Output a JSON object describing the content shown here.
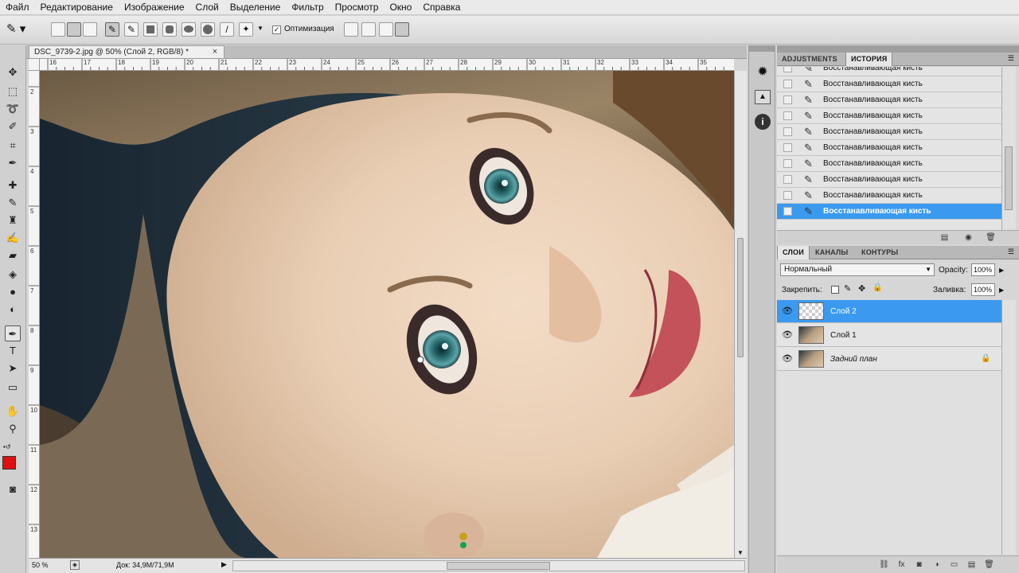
{
  "menu": [
    "Файл",
    "Редактирование",
    "Изображение",
    "Слой",
    "Выделение",
    "Фильтр",
    "Просмотр",
    "Окно",
    "Справка"
  ],
  "options_bar": {
    "optimize_label": "Оптимизация"
  },
  "document": {
    "tab_title": "DSC_9739-2.jpg @ 50% (Слой 2, RGB/8) *",
    "close_glyph": "×",
    "hruler_ticks": [
      "16",
      "17",
      "18",
      "19",
      "20",
      "21",
      "22",
      "23",
      "24",
      "25",
      "26",
      "27",
      "28",
      "29",
      "30",
      "31",
      "32",
      "33",
      "34",
      "35"
    ],
    "vruler_ticks": [
      "2",
      "3",
      "4",
      "5",
      "6",
      "7",
      "8",
      "9",
      "10",
      "11",
      "12",
      "13"
    ],
    "zoom": "50 %",
    "doc_info": "Док: 34,9M/71,9M"
  },
  "history_panel": {
    "tabs": [
      "ADJUSTMENTS",
      "ИСТОРИЯ"
    ],
    "active_tab": "ИСТОРИЯ",
    "items": [
      "Восстанавливающая кисть",
      "Восстанавливающая кисть",
      "Восстанавливающая кисть",
      "Восстанавливающая кисть",
      "Восстанавливающая кисть",
      "Восстанавливающая кисть",
      "Восстанавливающая кисть",
      "Восстанавливающая кисть",
      "Восстанавливающая кисть",
      "Восстанавливающая кисть"
    ],
    "selected_index": 9
  },
  "layers_panel": {
    "tabs": [
      "СЛОИ",
      "КАНАЛЫ",
      "КОНТУРЫ"
    ],
    "active_tab": "СЛОИ",
    "blend_mode": "Нормальный",
    "opacity_label": "Opacity:",
    "opacity_value": "100%",
    "lock_label": "Закрепить:",
    "fill_label": "Заливка:",
    "fill_value": "100%",
    "layers": [
      "Слой 2",
      "Слой 1",
      "Задний план"
    ],
    "selected_layer": "Слой 2"
  },
  "colors": {
    "foreground": "#e01010",
    "selection": "#3b9af0"
  }
}
